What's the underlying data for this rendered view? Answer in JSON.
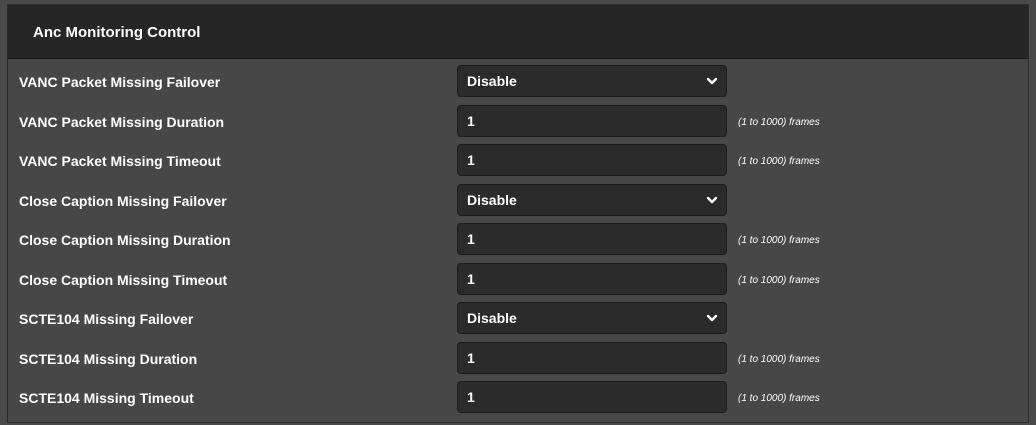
{
  "panel": {
    "title": "Anc Monitoring Control"
  },
  "rows": [
    {
      "label": "VANC Packet Missing Failover",
      "type": "select",
      "value": "Disable"
    },
    {
      "label": "VANC Packet Missing Duration",
      "type": "number",
      "value": "1",
      "hint": "(1 to 1000) frames"
    },
    {
      "label": "VANC Packet Missing Timeout",
      "type": "number",
      "value": "1",
      "hint": "(1 to 1000) frames"
    },
    {
      "label": "Close Caption Missing Failover",
      "type": "select",
      "value": "Disable"
    },
    {
      "label": "Close Caption Missing Duration",
      "type": "number",
      "value": "1",
      "hint": "(1 to 1000) frames"
    },
    {
      "label": "Close Caption Missing Timeout",
      "type": "number",
      "value": "1",
      "hint": "(1 to 1000) frames"
    },
    {
      "label": "SCTE104 Missing Failover",
      "type": "select",
      "value": "Disable"
    },
    {
      "label": "SCTE104 Missing Duration",
      "type": "number",
      "value": "1",
      "hint": "(1 to 1000) frames"
    },
    {
      "label": "SCTE104 Missing Timeout",
      "type": "number",
      "value": "1",
      "hint": "(1 to 1000) frames"
    }
  ],
  "icons": {
    "dropdown": "chevron-down-icon"
  }
}
